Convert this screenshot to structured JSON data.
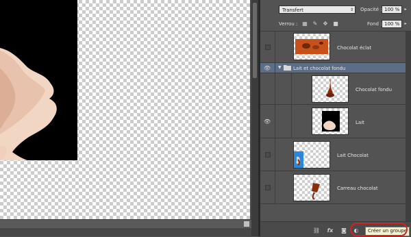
{
  "layers_panel": {
    "blend_mode": "Transfert",
    "opacity_label": "Opacité :",
    "opacity_value": "100 %",
    "lock_label": "Verrou :",
    "fill_label": "Fond :",
    "fill_value": "100 %",
    "layers": [
      {
        "name": "Chocolat éclat",
        "visible": false,
        "type": "layer"
      },
      {
        "name": "Lait et chocolat fondu",
        "visible": true,
        "type": "group",
        "selected": true
      },
      {
        "name": "Chocolat fondu",
        "visible": false,
        "type": "layer",
        "indent": true
      },
      {
        "name": "Lait",
        "visible": true,
        "type": "layer",
        "indent": true
      },
      {
        "name": "Lait Chocolat",
        "visible": false,
        "type": "layer"
      },
      {
        "name": "Carreau chocolat",
        "visible": false,
        "type": "layer"
      }
    ],
    "bottom_toolbar": {
      "icons": [
        "link-icon",
        "fx-icon",
        "mask-icon",
        "adjustment-icon"
      ],
      "tooltip": "Créer un groupe"
    }
  },
  "colors": {
    "panel_bg": "#535353",
    "selected_row": "#5d6d86",
    "highlight_ring": "#d42222",
    "tooltip_bg": "#f7f3d0"
  }
}
